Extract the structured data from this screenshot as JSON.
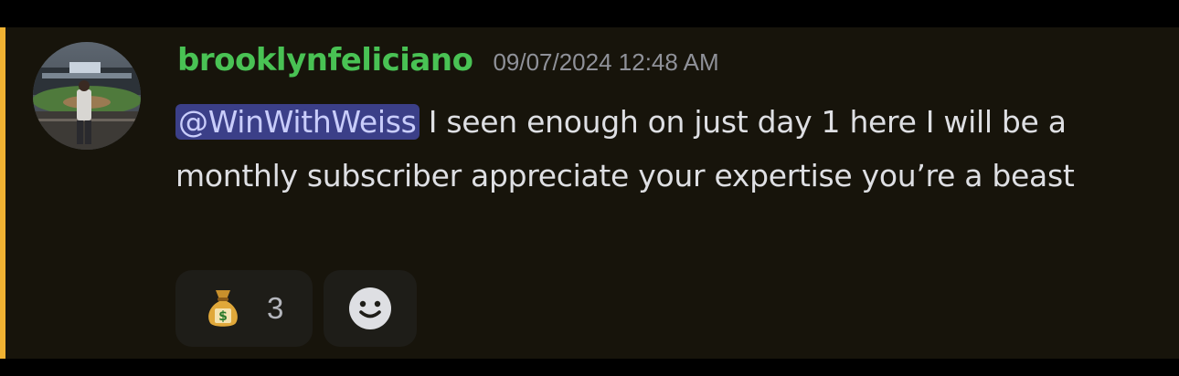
{
  "message": {
    "username": "brooklynfeliciano",
    "timestamp": "09/07/2024 12:48 AM",
    "mention": "@WinWithWeiss",
    "text": " I seen enough on just day 1 here I will be a monthly subscriber appreciate your expertise you’re a beast",
    "avatar": "baseball-stadium-photo",
    "username_color": "#49c254",
    "mention_bg": "#3b3f88",
    "highlight_color": "#f0b232"
  },
  "reactions": [
    {
      "emoji": "money-bag-icon",
      "count": "3"
    }
  ],
  "add_reaction": {
    "icon": "smiley-add-reaction-icon"
  }
}
